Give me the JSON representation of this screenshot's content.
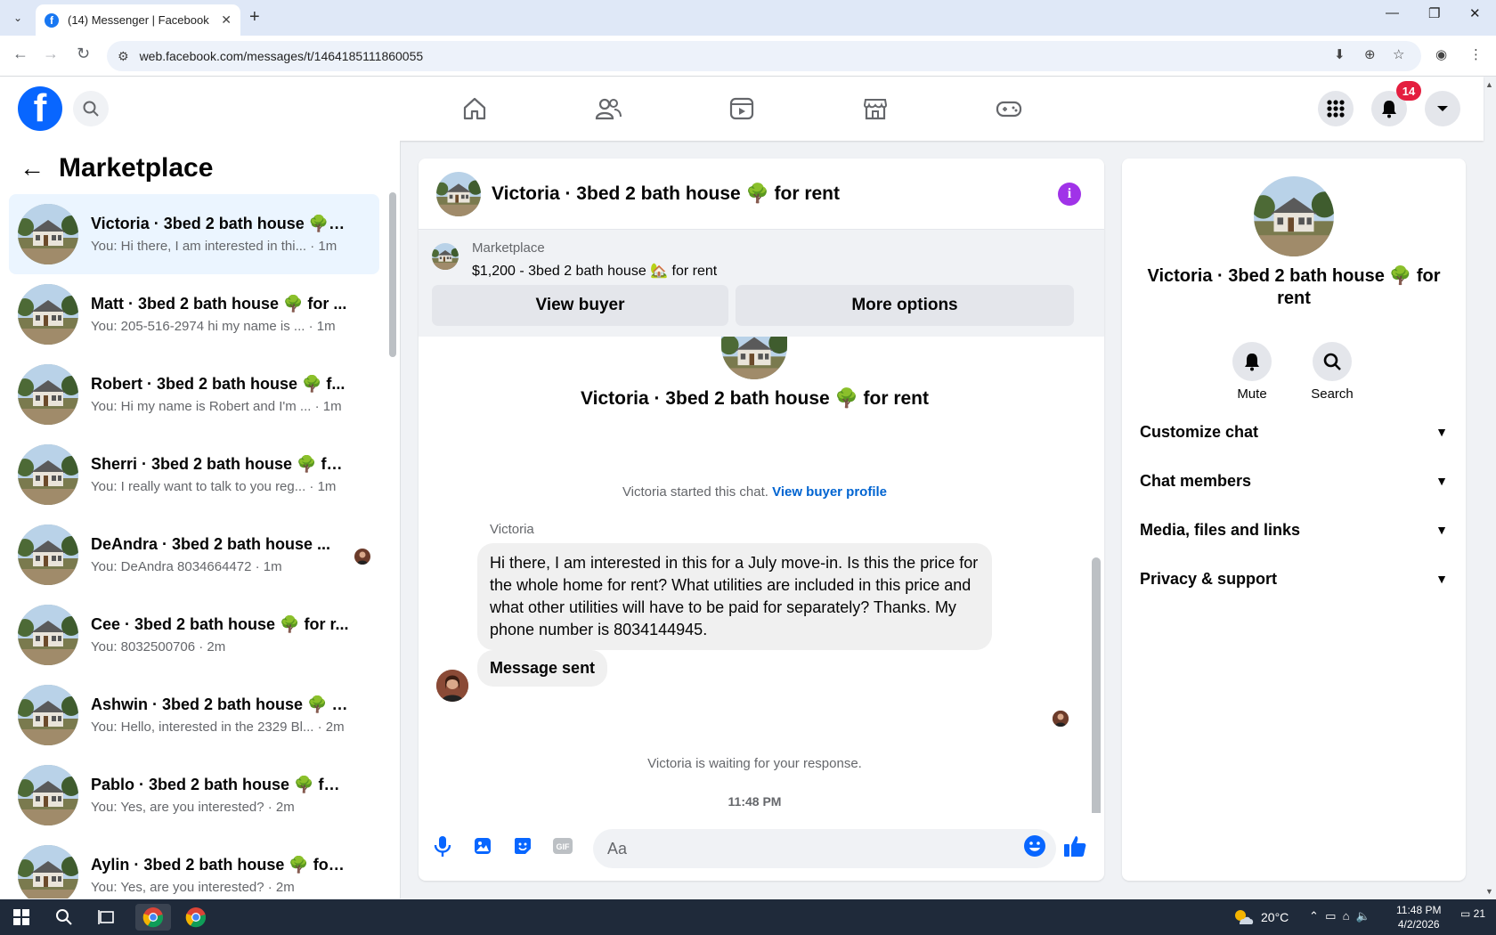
{
  "browser": {
    "tab_title": "(14) Messenger | Facebook",
    "url": "web.facebook.com/messages/t/1464185111860055"
  },
  "fb": {
    "logo_letter": "f",
    "notification_count": "14"
  },
  "left": {
    "title": "Marketplace",
    "conversations": [
      {
        "name": "Victoria · 3bed 2 bath house 🌳 f...",
        "preview": "You: Hi there, I am interested in thi... · 1m"
      },
      {
        "name": "Matt · 3bed 2 bath house 🌳 for ...",
        "preview": "You: 205-516-2974 hi my name is ... · 1m"
      },
      {
        "name": "Robert · 3bed 2 bath house 🌳 f...",
        "preview": "You: Hi my name is Robert and I'm ... · 1m"
      },
      {
        "name": "Sherri · 3bed 2 bath house 🌳 fo...",
        "preview": "You: I really want to talk to you reg... · 1m"
      },
      {
        "name": "DeAndra · 3bed 2 bath house ...",
        "preview": "You: DeAndra 8034664472 · 1m"
      },
      {
        "name": "Cee · 3bed 2 bath house 🌳 for r...",
        "preview": "You: 8032500706 · 2m"
      },
      {
        "name": "Ashwin · 3bed 2 bath house 🌳 f...",
        "preview": "You: Hello, interested in the 2329 Bl... · 2m"
      },
      {
        "name": "Pablo · 3bed 2 bath house 🌳 for...",
        "preview": "You: Yes, are you interested? · 2m"
      },
      {
        "name": "Aylin · 3bed 2 bath house 🌳 for ...",
        "preview": "You: Yes, are you interested? · 2m"
      }
    ]
  },
  "chat": {
    "header_title": "Victoria · 3bed 2 bath house 🌳 for rent",
    "marketplace_label": "Marketplace",
    "listing": "$1,200 - 3bed 2 bath house 🏡 for rent",
    "view_buyer": "View buyer",
    "more_options": "More options",
    "body_title": "Victoria · 3bed 2 bath house 🌳 for rent",
    "started_text": "Victoria started this chat.",
    "view_buyer_profile": "View buyer profile",
    "sender_name": "Victoria",
    "message1": "Hi there, I am interested in this for a July move-in. Is this the price for the whole home for rent? What utilities are included in this price and what other utilities will have to be paid for separately? Thanks. My phone number is 8034144945.",
    "message2": "Message sent",
    "waiting": "Victoria is waiting for your response.",
    "timestamp": "11:48 PM",
    "input_placeholder": "Aa"
  },
  "info": {
    "name": "Victoria · 3bed 2 bath house 🌳 for rent",
    "mute_label": "Mute",
    "search_label": "Search",
    "sections": [
      "Customize chat",
      "Chat members",
      "Media, files and links",
      "Privacy & support"
    ]
  },
  "taskbar": {
    "temperature": "20°C",
    "time": "11:48 PM",
    "date": "4/2/2026",
    "notifications": "21"
  }
}
